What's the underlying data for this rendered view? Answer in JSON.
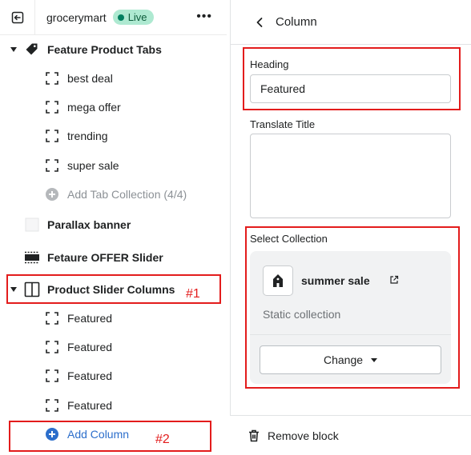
{
  "topbar": {
    "store_name": "grocerymart",
    "live_label": "Live",
    "more_label": "•••"
  },
  "tree": {
    "feature_tabs": {
      "label": "Feature Product Tabs"
    },
    "tab_items": [
      {
        "label": "best deal"
      },
      {
        "label": "mega offer"
      },
      {
        "label": "trending"
      },
      {
        "label": "super sale"
      }
    ],
    "add_tab": {
      "label": "Add Tab Collection (4/4)"
    },
    "parallax": {
      "label": "Parallax banner"
    },
    "offer_slider": {
      "label": "Fetaure OFFER Slider"
    },
    "slider_columns": {
      "label": "Product Slider Columns"
    },
    "column_items": [
      {
        "label": "Featured"
      },
      {
        "label": "Featured"
      },
      {
        "label": "Featured"
      },
      {
        "label": "Featured"
      }
    ],
    "add_column": {
      "label": "Add Column"
    }
  },
  "annotations": {
    "first": "#1",
    "second": "#2"
  },
  "panel": {
    "title": "Column",
    "heading_label": "Heading",
    "heading_value": "Featured",
    "translate_label": "Translate Title",
    "translate_value": "",
    "collection_label": "Select Collection",
    "collection_name": "summer sale",
    "collection_type": "Static collection",
    "change_label": "Change",
    "remove_label": "Remove block"
  },
  "colors": {
    "accent": "#2c6ecb",
    "live_bg": "#aee9d1",
    "annotation": "#e31c1c"
  }
}
